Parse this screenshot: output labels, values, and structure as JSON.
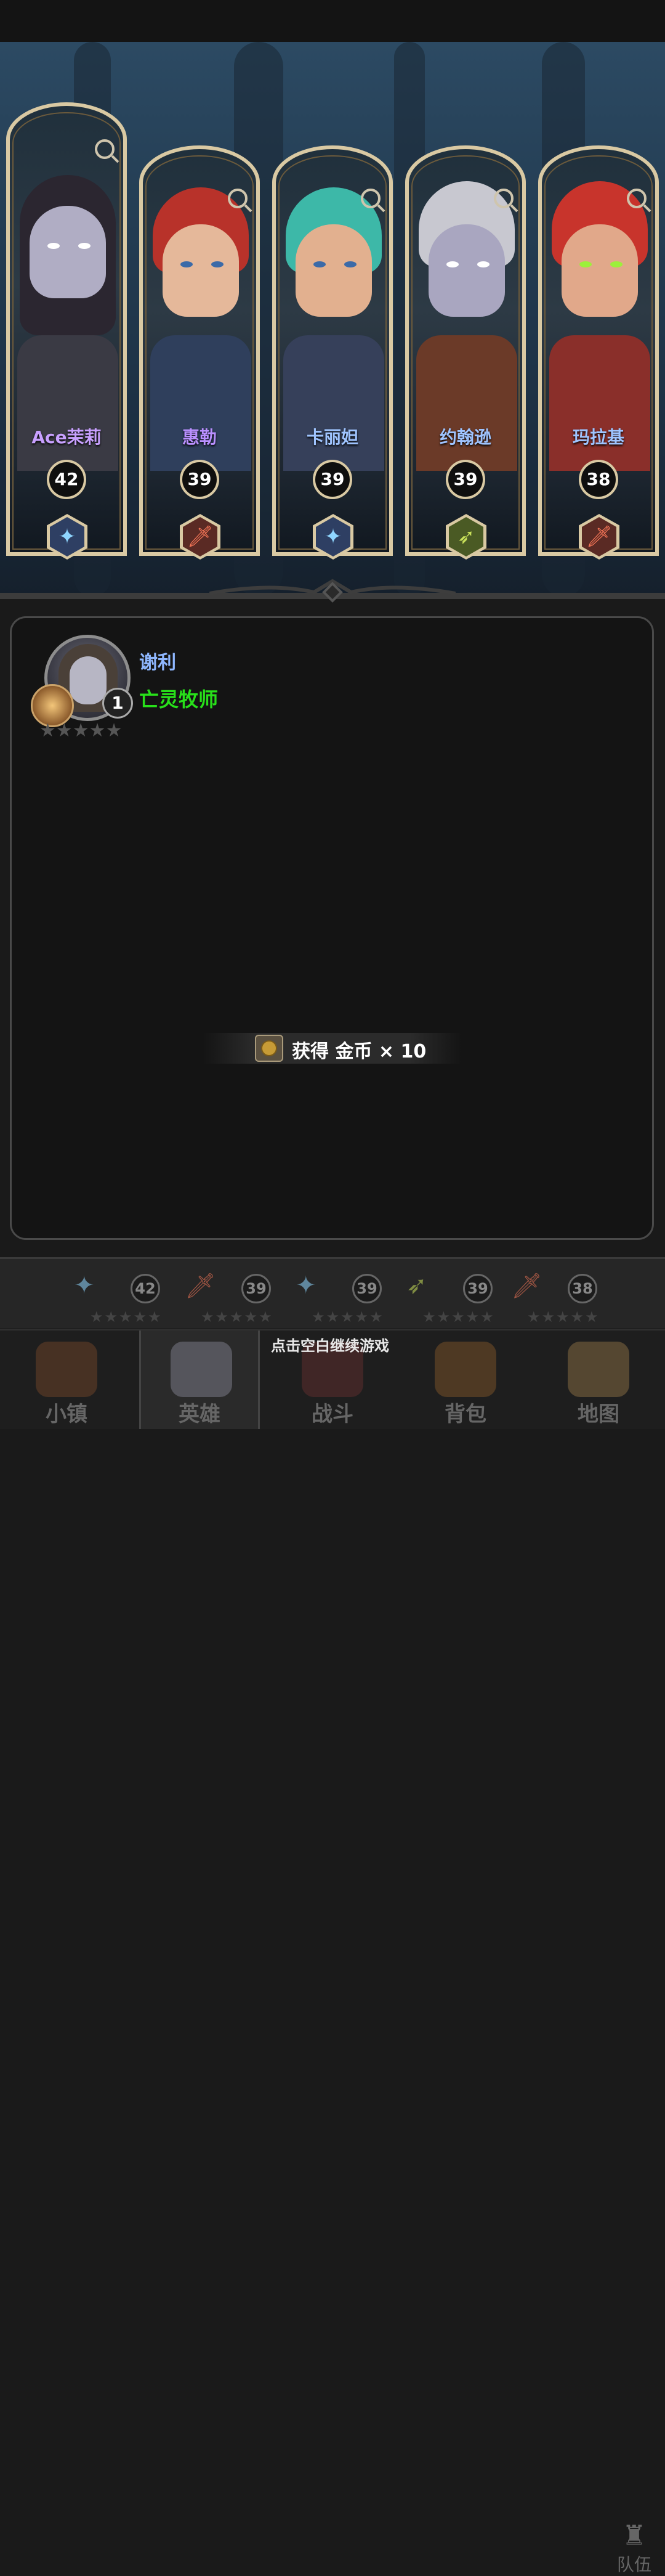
{
  "roster": [
    {
      "name": "Ace茉莉",
      "name_color": "#c8a0ff",
      "level": "42",
      "weapon": "staff-icon",
      "glyph": "✦",
      "hex_bg": "#2e3f63"
    },
    {
      "name": "惠勒",
      "name_color": "#b990ff",
      "level": "39",
      "weapon": "sword-icon",
      "glyph": "🗡",
      "hex_bg": "#5a2a24"
    },
    {
      "name": "卡丽妲",
      "name_color": "#9fc4ff",
      "level": "39",
      "weapon": "staff-icon",
      "glyph": "✦",
      "hex_bg": "#2e3f63"
    },
    {
      "name": "约翰逊",
      "name_color": "#9fc4ff",
      "level": "39",
      "weapon": "bow-icon",
      "glyph": "➶",
      "hex_bg": "#4a5a24"
    },
    {
      "name": "玛拉基",
      "name_color": "#9fc4ff",
      "level": "38",
      "weapon": "sword-icon",
      "glyph": "🗡",
      "hex_bg": "#5a2a24"
    }
  ],
  "selected_hero": {
    "name": "谢利",
    "class": "亡灵牧师",
    "level": "1",
    "stars": "★★★★★"
  },
  "reward": {
    "text": "获得 金币 × 10"
  },
  "team_bar": {
    "levels": [
      "42",
      "39",
      "39",
      "39",
      "38"
    ],
    "label": "队伍"
  },
  "hint": "点击空白继续游戏",
  "nav": [
    "小镇",
    "英雄",
    "战斗",
    "背包",
    "地图"
  ]
}
